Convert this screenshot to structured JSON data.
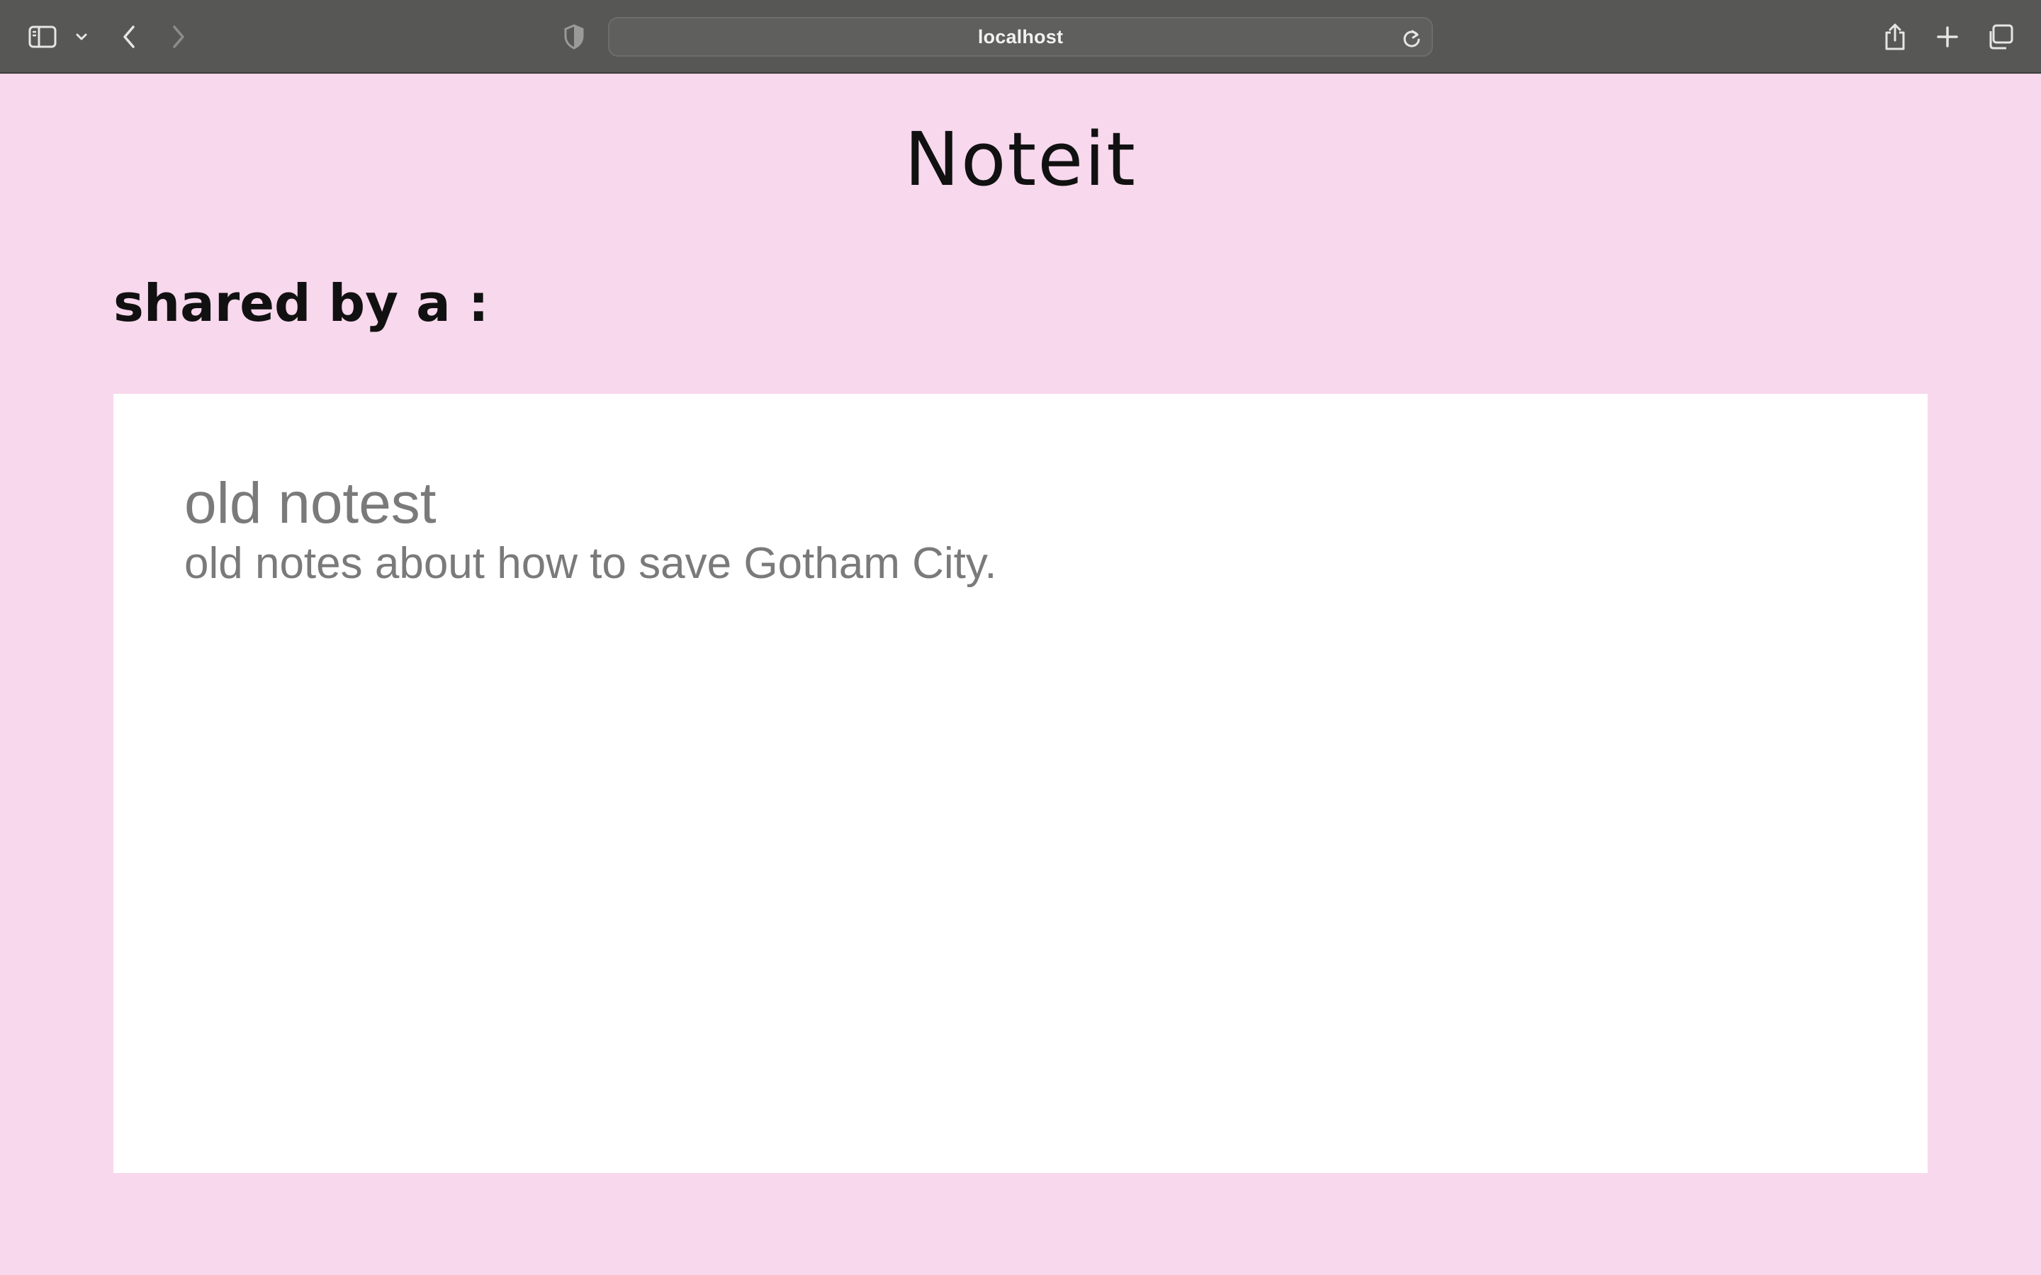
{
  "browser": {
    "url": "localhost",
    "icons": {
      "sidebar": "sidebar-icon",
      "sidebar_menu": "chevron-down-icon",
      "back": "chevron-left-icon",
      "forward": "chevron-right-icon",
      "privacy": "shield-icon",
      "reload": "reload-icon",
      "share": "share-icon",
      "new_tab": "plus-icon",
      "tabs": "tab-overview-icon"
    }
  },
  "page": {
    "app_title": "Noteit",
    "shared_by": "shared by a :",
    "background_color": "#f8d8ed",
    "note": {
      "title": "old notest",
      "content": "old notes about how to save Gotham City."
    }
  }
}
